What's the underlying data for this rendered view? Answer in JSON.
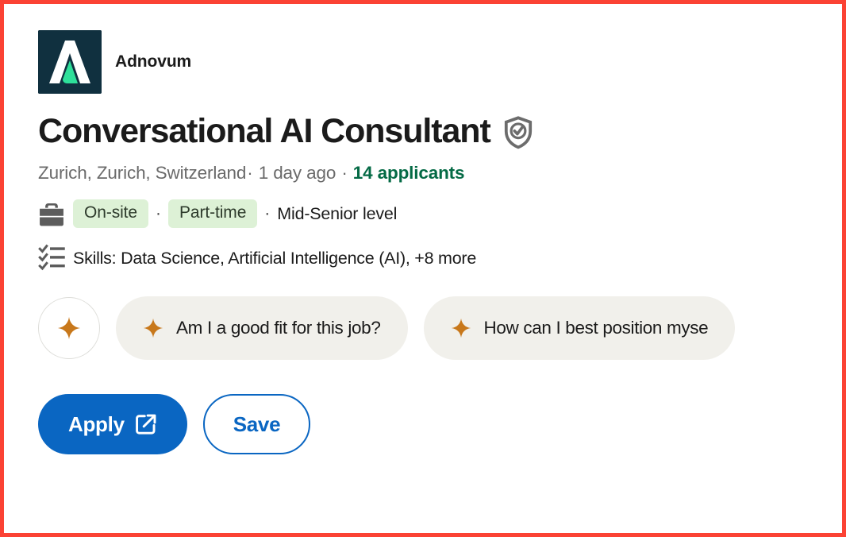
{
  "frame": {
    "highlight_color": "#fb4234"
  },
  "company": {
    "name": "Adnovum",
    "logo_icon": "adnovum-logo",
    "logo_bg_color": "#10303f",
    "logo_mark_color": "#ffffff",
    "logo_accent_color": "#2ee09a"
  },
  "job": {
    "title": "Conversational AI Consultant",
    "verified_icon": "verified-shield-icon",
    "location": "Zurich, Zurich, Switzerland",
    "separator": "·",
    "posted": "1 day ago",
    "applicants": "14 applicants",
    "applicants_color": "#046a45",
    "workplace_icon": "briefcase-icon",
    "badges": [
      "On-site",
      "Part-time"
    ],
    "badge_bg_color": "#ddf1d6",
    "experience_level": "Mid-Senior level",
    "skills_icon": "checklist-icon",
    "skills": "Skills: Data Science, Artificial Intelligence (AI), +8 more"
  },
  "ai_assist": {
    "sparkle_icon": "sparkle-icon",
    "sparkle_color": "#c8781b",
    "toggle_button_name": "ai-assistant-button",
    "prompts": [
      "Am I a good fit for this job?",
      "How can I best position myse"
    ]
  },
  "actions": {
    "apply_label": "Apply",
    "apply_icon": "external-link-icon",
    "apply_color": "#0a66c2",
    "save_label": "Save"
  }
}
